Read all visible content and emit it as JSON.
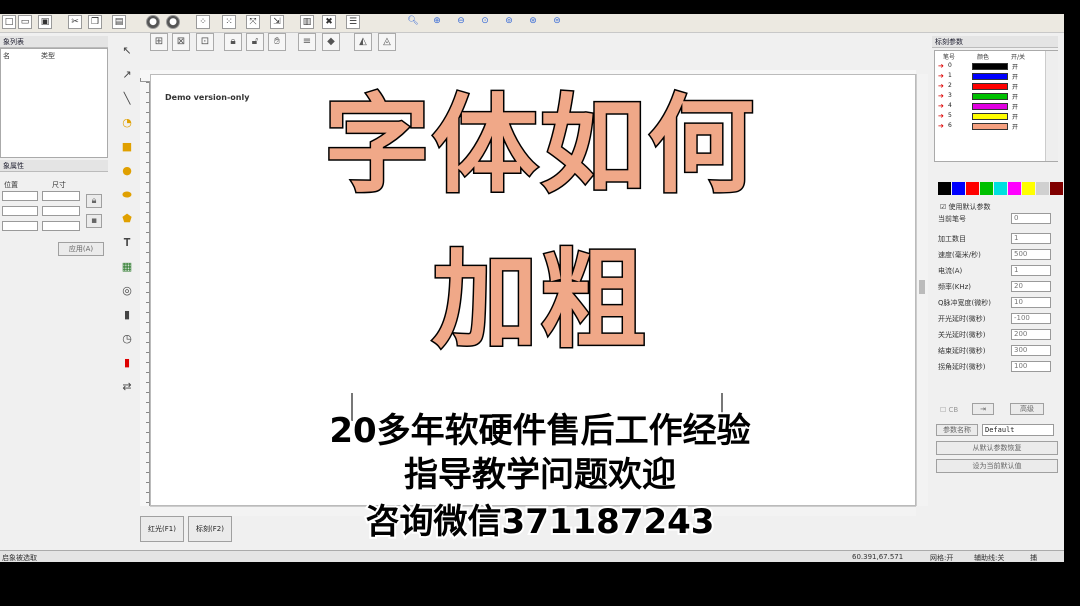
{
  "left_panel": {
    "object_list_title": "象列表",
    "columns": [
      "名",
      "类型"
    ],
    "props_title": "象属性",
    "pos_label": "位置",
    "size_label": "尺寸",
    "apply_button": "应用(A)"
  },
  "canvas": {
    "demo_text": "Demo version-only"
  },
  "bottom_buttons": {
    "red_light": "红光(F1)",
    "mark": "标刻(F2)"
  },
  "status_bar": {
    "left_text": "启象被选取",
    "coords": "60.391,67.571",
    "grid": "网格:开",
    "guide": "辅助线:关",
    "snap": "捕"
  },
  "right_panel": {
    "title": "标刻参数",
    "pen_headers": [
      "笔号",
      "颜色",
      "开/关"
    ],
    "pens": [
      {
        "n": "0",
        "color": "#000000",
        "on": "开"
      },
      {
        "n": "1",
        "color": "#0000ff",
        "on": "开"
      },
      {
        "n": "2",
        "color": "#ff0000",
        "on": "开"
      },
      {
        "n": "3",
        "color": "#00c000",
        "on": "开"
      },
      {
        "n": "4",
        "color": "#e000e0",
        "on": "开"
      },
      {
        "n": "5",
        "color": "#ffff00",
        "on": "开"
      },
      {
        "n": "6",
        "color": "#f5a080",
        "on": "开"
      }
    ],
    "palette": [
      "#000000",
      "#0000ff",
      "#ff0000",
      "#00c000",
      "#00e0e0",
      "#ff00ff",
      "#ffff00",
      "#d0d0d0",
      "#800000"
    ],
    "use_default_label": "使用默认参数",
    "current_pen_label": "当前笔号",
    "current_pen_value": "0",
    "params": [
      {
        "label": "加工数目",
        "value": "1"
      },
      {
        "label": "速度(毫米/秒)",
        "value": "500"
      },
      {
        "label": "电流(A)",
        "value": "1"
      },
      {
        "label": "频率(KHz)",
        "value": "20"
      },
      {
        "label": "Q脉冲宽度(微秒)",
        "value": "10"
      },
      {
        "label": "开光延时(微秒)",
        "value": "-100"
      },
      {
        "label": "关光延时(微秒)",
        "value": "200"
      },
      {
        "label": "结束延时(微秒)",
        "value": "300"
      },
      {
        "label": "拐角延时(微秒)",
        "value": "100"
      }
    ],
    "cb_label": "CB",
    "advanced_button": "高级",
    "param_name_button": "参数名称",
    "param_name_value": "Default",
    "save_default_button": "从默认参数恢复",
    "set_default_button": "设为当前默认值"
  },
  "overlay": {
    "title_line1": "字体如何",
    "title_line2": "加粗",
    "caption_line1": "20多年软硬件售后工作经验",
    "caption_line2": "指导教学问题欢迎",
    "caption_line3": "咨询微信371187243"
  }
}
